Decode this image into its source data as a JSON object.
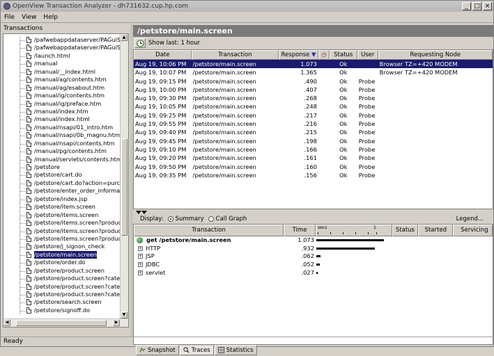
{
  "window": {
    "title": "OpenView Transaction Analyzer - dh731632.cup.hp.com"
  },
  "menu": [
    "File",
    "View",
    "Help"
  ],
  "left_panel": {
    "header": "Transactions",
    "items": [
      "/pafwebappdataserver/PAGuiS",
      "/pafwebappdataserver/PAGuiS",
      "/launch.html",
      "/manual",
      "/manual/__index.html",
      "/manual/ag/contents.htm",
      "/manual/ag/esabout.htm",
      "/manual/ig/contents.htm",
      "/manual/ig/preface.htm",
      "/manual/index.htm",
      "/manual/index.html",
      "/manual/nsapi/01_intro.htm",
      "/manual/nsapi/0b_magnu.htm",
      "/manual/nsapi/contents.htm",
      "/manual/pg/contents.htm",
      "/manual/servlets/contents.htm",
      "/petstore",
      "/petstore/cart.do",
      "/petstore/cart.do?action=purcha",
      "/petstore/enter_order_informati",
      "/petstore/index.jsp",
      "/petstore/item.screen",
      "/petstore/items.screen",
      "/petstore/items.screen?product",
      "/petstore/items.screen?product",
      "/petstore/items.screen?product",
      "/petstore/j_signon_check",
      "/petstore/main.screen",
      "/petstore/order.do",
      "/petstore/product.screen",
      "/petstore/product.screen?catego",
      "/petstore/product.screen?catego",
      "/petstore/product.screen?catego",
      "/petstore/search.screen",
      "/petstore/signoff.do"
    ],
    "selected_index": 27
  },
  "main": {
    "title": "/petstore/main.screen",
    "show_label": "Show last: 1 hour",
    "table": {
      "columns": [
        "Date",
        "Transaction",
        "Response",
        "",
        "Status",
        "User",
        "Requesting Node"
      ],
      "rows": [
        [
          "Aug 19, 10:06 PM",
          "/petstore/main.screen",
          "1.073",
          "",
          "Ok",
          "",
          "Browser TZ=+420 MODEM"
        ],
        [
          "Aug 19, 10:07 PM",
          "/petstore/main.screen",
          "1.365",
          "",
          "Ok",
          "",
          "Browser TZ=+420 MODEM"
        ],
        [
          "Aug 19, 09:15 PM",
          "/petstore/main.screen",
          ".490",
          "",
          "Ok",
          "Probe",
          ""
        ],
        [
          "Aug 19, 10:00 PM",
          "/petstore/main.screen",
          ".407",
          "",
          "Ok",
          "Probe",
          ""
        ],
        [
          "Aug 19, 09:30 PM",
          "/petstore/main.screen",
          ".268",
          "",
          "Ok",
          "Probe",
          ""
        ],
        [
          "Aug 19, 10:05 PM",
          "/petstore/main.screen",
          ".248",
          "",
          "Ok",
          "Probe",
          ""
        ],
        [
          "Aug 19, 09:25 PM",
          "/petstore/main.screen",
          ".217",
          "",
          "Ok",
          "Probe",
          ""
        ],
        [
          "Aug 19, 09:55 PM",
          "/petstore/main.screen",
          ".216",
          "",
          "Ok",
          "Probe",
          ""
        ],
        [
          "Aug 19, 09:40 PM",
          "/petstore/main.screen",
          ".215",
          "",
          "Ok",
          "Probe",
          ""
        ],
        [
          "Aug 19, 09:45 PM",
          "/petstore/main.screen",
          ".198",
          "",
          "Ok",
          "Probe",
          ""
        ],
        [
          "Aug 19, 09:10 PM",
          "/petstore/main.screen",
          ".166",
          "",
          "Ok",
          "Probe",
          ""
        ],
        [
          "Aug 19, 09:20 PM",
          "/petstore/main.screen",
          ".161",
          "",
          "Ok",
          "Probe",
          ""
        ],
        [
          "Aug 19, 09:50 PM",
          "/petstore/main.screen",
          ".160",
          "",
          "Ok",
          "Probe",
          ""
        ],
        [
          "Aug 19, 09:35 PM",
          "/petstore/main.screen",
          ".156",
          "",
          "Ok",
          "Probe",
          ""
        ]
      ],
      "selected_row": 0
    },
    "display": {
      "label": "Display:",
      "options": [
        "Summary",
        "Call Graph"
      ],
      "selected": "Summary",
      "legend": "Legend..."
    },
    "components": {
      "columns": [
        "Transaction",
        "Time",
        "",
        "Status",
        "Started",
        "Servicing"
      ],
      "scale_label_left": "secs",
      "scale_label_right": "1",
      "rows": [
        {
          "name": "get /petstore/main.screen",
          "time": "1.073",
          "value": 1.073,
          "root": true
        },
        {
          "name": "HTTP",
          "time": ".932",
          "value": 0.932,
          "root": false
        },
        {
          "name": "JSP",
          "time": ".062",
          "value": 0.062,
          "root": false
        },
        {
          "name": "JDBC",
          "time": ".052",
          "value": 0.052,
          "root": false
        },
        {
          "name": "servlet",
          "time": ".027",
          "value": 0.027,
          "root": false
        }
      ]
    },
    "tabs": [
      "Snapshot",
      "Traces",
      "Statistics"
    ],
    "active_tab": "Traces"
  },
  "status": "Ready"
}
